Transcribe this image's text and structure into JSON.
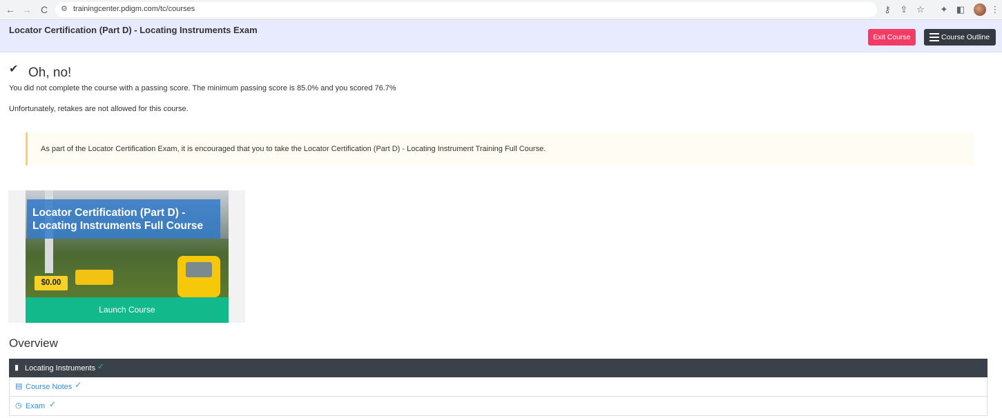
{
  "browser": {
    "url": "trainingcenter.pdigm.com/tc/courses",
    "icons": [
      "back-icon",
      "forward-icon",
      "reload-icon",
      "site-settings-icon",
      "password-key-icon",
      "share-icon",
      "bookmark-star-icon",
      "extensions-icon",
      "side-panel-icon",
      "profile-avatar",
      "more-menu-icon"
    ]
  },
  "header": {
    "title": "Locator Certification (Part D) - Locating Instruments Exam",
    "exit_label": "Exit Course",
    "outline_label": "Course Outline",
    "colors": {
      "exit": "#f23c66",
      "outline": "#343a40",
      "bar": "#e8eafd"
    }
  },
  "result": {
    "title": "Oh, no!",
    "score_message": "You did not complete the course with a passing score. The minimum passing score is 85.0% and you scored 76.7%",
    "retake_message": "Unfortunately, retakes are not allowed for this course."
  },
  "notice": {
    "text": "As part of the Locator Certification Exam, it is encouraged that you to take the Locator Certification (Part D) - Locating Instrument Training Full Course."
  },
  "course_card": {
    "title": "Locator Certification (Part D) - Locating Instruments Full Course",
    "price": "$0.00",
    "launch_label": "Launch Course",
    "colors": {
      "launch": "#12b98a",
      "price": "#f6d128"
    }
  },
  "overview": {
    "heading": "Overview",
    "section": {
      "label": "Locating Instruments",
      "completed": true
    },
    "items": [
      {
        "label": "Course Notes",
        "icon": "book-icon",
        "completed": true
      },
      {
        "label": "Exam",
        "icon": "clock-icon",
        "completed": true
      }
    ]
  }
}
